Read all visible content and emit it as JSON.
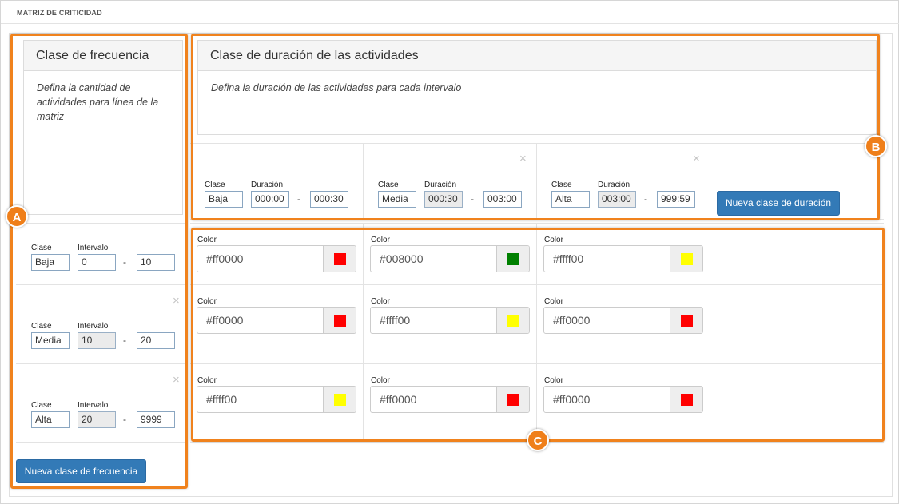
{
  "section_title": "MATRIZ DE CRITICIDAD",
  "frequency_panel": {
    "title": "Clase de frecuencia",
    "description": "Defina la cantidad de actividades para línea de la matriz"
  },
  "duration_panel": {
    "title": "Clase de duración de las actividades",
    "description": "Defina la duración de las actividades para cada intervalo"
  },
  "labels": {
    "clase": "Clase",
    "intervalo": "Intervalo",
    "duracion": "Duración",
    "color": "Color",
    "dash": "-",
    "remove": "×"
  },
  "frequency_rows": [
    {
      "clase": "Baja",
      "from": "0",
      "to": "10"
    },
    {
      "clase": "Media",
      "from": "10",
      "to": "20"
    },
    {
      "clase": "Alta",
      "from": "20",
      "to": "9999"
    }
  ],
  "duration_cols": [
    {
      "clase": "Baja",
      "from": "000:00",
      "to": "000:30"
    },
    {
      "clase": "Media",
      "from": "000:30",
      "to": "003:00"
    },
    {
      "clase": "Alta",
      "from": "003:00",
      "to": "999:59"
    }
  ],
  "buttons": {
    "new_duration": "Nueva clase de duración",
    "new_frequency": "Nueva clase de frecuencia"
  },
  "color_matrix": [
    [
      "#ff0000",
      "#008000",
      "#ffff00"
    ],
    [
      "#ff0000",
      "#ffff00",
      "#ff0000"
    ],
    [
      "#ffff00",
      "#ff0000",
      "#ff0000"
    ]
  ],
  "markers": {
    "a": "A",
    "b": "B",
    "c": "C"
  },
  "colors": {
    "accent": "#337ab7",
    "highlight": "#f0821d"
  }
}
